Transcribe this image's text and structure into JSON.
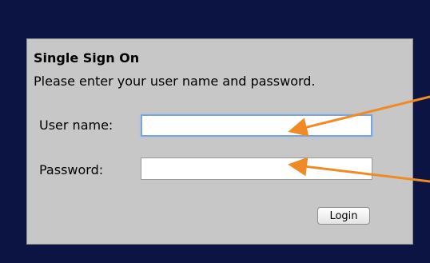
{
  "screen": {
    "background_color": "#0b1442"
  },
  "login_panel": {
    "background_color": "#c7c7c7",
    "title": "Single Sign On",
    "instructions": "Please enter your user name and password.",
    "username": {
      "label": "User name:",
      "value": ""
    },
    "password": {
      "label": "Password:",
      "value": ""
    },
    "login_button_label": "Login"
  },
  "annotations": {
    "arrow_color": "#f08a24",
    "arrows": [
      {
        "points_to": "username-input"
      },
      {
        "points_to": "password-input"
      }
    ]
  }
}
